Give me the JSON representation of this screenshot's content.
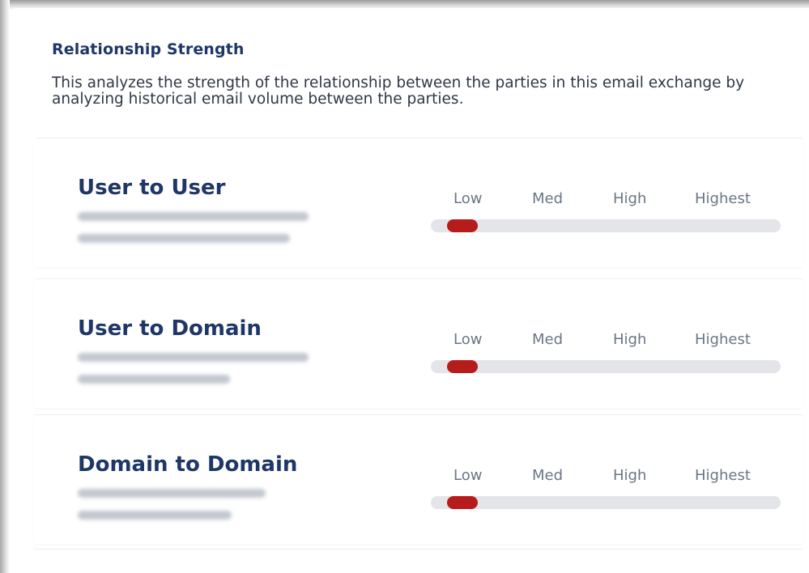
{
  "header": {
    "title": "Relationship Strength",
    "description": "This analyzes the strength of the relationship between the parties in this email exchange by analyzing historical email volume between the parties."
  },
  "scale": {
    "labels": [
      "Low",
      "Med",
      "High",
      "Highest"
    ],
    "marker_color": "#b71c1c",
    "track_color": "#e3e5e8"
  },
  "rows": [
    {
      "title": "User to User",
      "from_redacted": true,
      "to_redacted": true,
      "strength": "Low",
      "level": 0.09
    },
    {
      "title": "User to Domain",
      "from_redacted": true,
      "to_redacted": true,
      "strength": "Low",
      "level": 0.09
    },
    {
      "title": "Domain to Domain",
      "from_redacted": true,
      "to_redacted": true,
      "strength": "Low",
      "level": 0.09
    }
  ]
}
